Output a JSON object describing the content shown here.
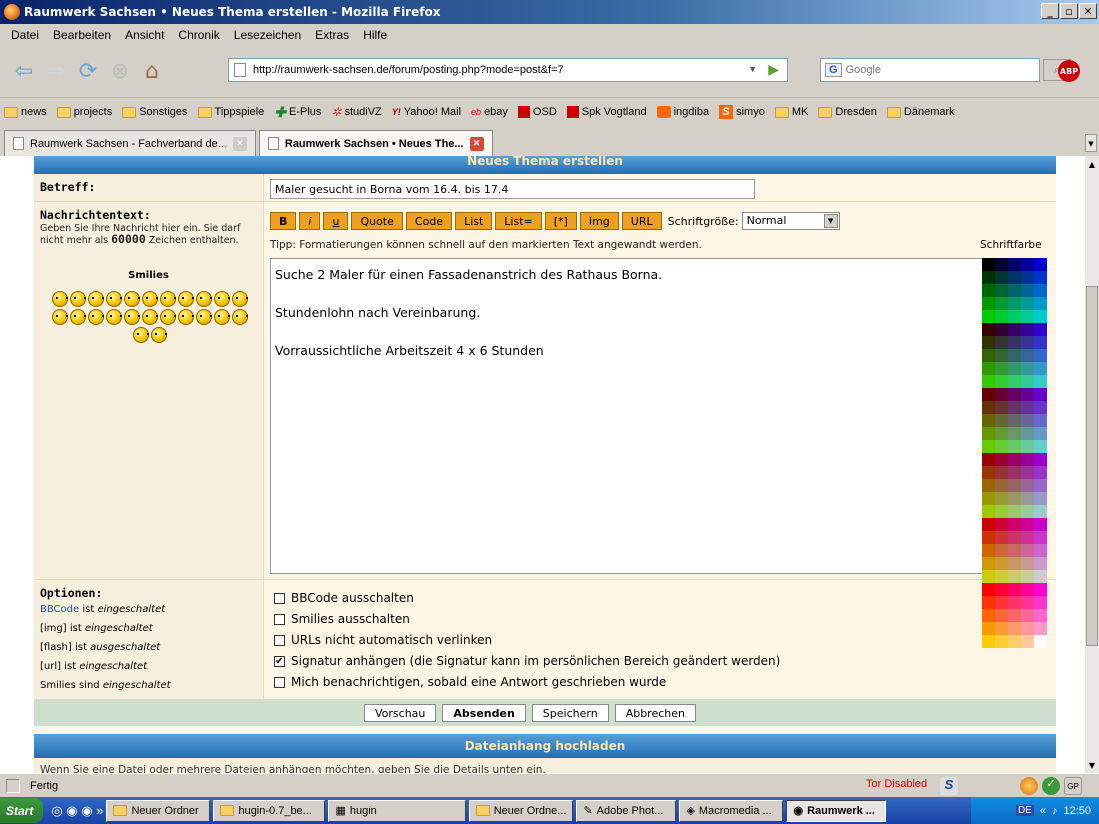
{
  "window": {
    "title": "Raumwerk Sachsen • Neues Thema erstellen - Mozilla Firefox"
  },
  "menu": [
    "Datei",
    "Bearbeiten",
    "Ansicht",
    "Chronik",
    "Lesezeichen",
    "Extras",
    "Hilfe"
  ],
  "nav": {
    "url": "http://raumwerk-sachsen.de/forum/posting.php?mode=post&f=7",
    "search_placeholder": "Google",
    "search_engine": "G",
    "adblock": "ABP"
  },
  "bookmarks": [
    {
      "label": "news",
      "icon": "folder"
    },
    {
      "label": "projects",
      "icon": "folder"
    },
    {
      "label": "Sonstiges",
      "icon": "folder"
    },
    {
      "label": "Tippspiele",
      "icon": "folder"
    },
    {
      "label": "E-Plus",
      "icon": "eplus"
    },
    {
      "label": "studiVZ",
      "icon": "studivz"
    },
    {
      "label": "Yahoo! Mail",
      "icon": "yahoo"
    },
    {
      "label": "ebay",
      "icon": "ebay"
    },
    {
      "label": "OSD",
      "icon": "sparkasse"
    },
    {
      "label": "Spk Vogtland",
      "icon": "sparkasse"
    },
    {
      "label": "ingdiba",
      "icon": "ingdiba"
    },
    {
      "label": "simyo",
      "icon": "simyo"
    },
    {
      "label": "MK",
      "icon": "folder"
    },
    {
      "label": "Dresden",
      "icon": "folder"
    },
    {
      "label": "Dänemark",
      "icon": "folder"
    }
  ],
  "tabs": [
    {
      "label": "Raumwerk Sachsen - Fachverband de...",
      "active": false
    },
    {
      "label": "Raumwerk Sachsen • Neues The...",
      "active": true
    }
  ],
  "form": {
    "header": "Neues Thema erstellen",
    "subject_label": "Betreff:",
    "subject_value": "Maler gesucht in Borna vom 16.4. bis 17.4",
    "message_label": "Nachrichtentext:",
    "message_hint": "Geben Sie Ihre Nachricht hier ein. Sie darf nicht mehr als ",
    "message_limit": "60000",
    "message_hint_end": " Zeichen enthalten.",
    "smilies_title": "Smilies",
    "bbcode_buttons": [
      "B",
      "i",
      "u",
      "Quote",
      "Code",
      "List",
      "List=",
      "[*]",
      "Img",
      "URL"
    ],
    "font_size_label": "Schriftgröße:",
    "font_size_value": "Normal",
    "tip": "Tipp: Formatierungen können schnell auf den markierten Text angewandt werden.",
    "font_color_label": "Schriftfarbe",
    "message_text": "Suche 2 Maler für einen Fassadenanstrich des Rathaus Borna.\n\nStundenlohn nach Vereinbarung.\n\nVorraussichtliche Arbeitszeit 4 x 6 Stunden",
    "options_label": "Optionen:",
    "options_status": [
      {
        "name": "BBCode",
        "text": " ist ",
        "state": "eingeschaltet"
      },
      {
        "name": "[img]",
        "text": " ist ",
        "state": "eingeschaltet"
      },
      {
        "name": "[flash]",
        "text": " ist ",
        "state": "ausgeschaltet"
      },
      {
        "name": "[url]",
        "text": " ist ",
        "state": "eingeschaltet"
      },
      {
        "name": "Smilies",
        "text": " sind ",
        "state": "eingeschaltet"
      }
    ],
    "checkboxes": [
      {
        "label": "BBCode ausschalten",
        "checked": false
      },
      {
        "label": "Smilies ausschalten",
        "checked": false
      },
      {
        "label": "URLs nicht automatisch verlinken",
        "checked": false
      },
      {
        "label": "Signatur anhängen (die Signatur kann im persönlichen Bereich geändert werden)",
        "checked": true
      },
      {
        "label": "Mich benachrichtigen, sobald eine Antwort geschrieben wurde",
        "checked": false
      }
    ],
    "buttons": [
      "Vorschau",
      "Absenden",
      "Speichern",
      "Abbrechen"
    ],
    "attach_header": "Dateianhang hochladen",
    "attach_hint": "Wenn Sie eine Datei oder mehrere Dateien anhängen möchten, geben Sie die Details unten ein."
  },
  "status": {
    "text": "Fertig",
    "tor": "Tor Disabled"
  },
  "taskbar": {
    "start": "Start",
    "items": [
      {
        "label": "Neuer Ordner",
        "active": false
      },
      {
        "label": "hugin-0.7_be...",
        "active": false
      },
      {
        "label": "hugin",
        "active": false
      },
      {
        "label": "Neuer Ordne...",
        "active": false
      },
      {
        "label": "Adobe Phot...",
        "active": false
      },
      {
        "label": "Macromedia ...",
        "active": false
      },
      {
        "label": "Raumwerk ...",
        "active": true
      }
    ],
    "lang": "DE",
    "clock": "12:50"
  },
  "palette_colors": [
    "#000000",
    "#000033",
    "#000066",
    "#000099",
    "#0000cc",
    "#003300",
    "#003333",
    "#003366",
    "#003399",
    "#0033cc",
    "#006600",
    "#006633",
    "#006666",
    "#006699",
    "#0066cc",
    "#009900",
    "#009933",
    "#009966",
    "#009999",
    "#0099cc",
    "#00cc00",
    "#00cc33",
    "#00cc66",
    "#00cc99",
    "#00cccc",
    "#330000",
    "#330033",
    "#330066",
    "#330099",
    "#3300cc",
    "#333300",
    "#333333",
    "#333366",
    "#333399",
    "#3333cc",
    "#336600",
    "#336633",
    "#336666",
    "#336699",
    "#3366cc",
    "#339900",
    "#339933",
    "#339966",
    "#339999",
    "#3399cc",
    "#33cc00",
    "#33cc33",
    "#33cc66",
    "#33cc99",
    "#33cccc",
    "#660000",
    "#660033",
    "#660066",
    "#660099",
    "#6600cc",
    "#663300",
    "#663333",
    "#663366",
    "#663399",
    "#6633cc",
    "#666600",
    "#666633",
    "#666666",
    "#666699",
    "#6666cc",
    "#669900",
    "#669933",
    "#669966",
    "#669999",
    "#6699cc",
    "#66cc00",
    "#66cc33",
    "#66cc66",
    "#66cc99",
    "#66cccc",
    "#990000",
    "#990033",
    "#990066",
    "#990099",
    "#9900cc",
    "#993300",
    "#993333",
    "#993366",
    "#993399",
    "#9933cc",
    "#996600",
    "#996633",
    "#996666",
    "#996699",
    "#9966cc",
    "#999900",
    "#999933",
    "#999966",
    "#999999",
    "#9999cc",
    "#99cc00",
    "#99cc33",
    "#99cc66",
    "#99cc99",
    "#99cccc",
    "#cc0000",
    "#cc0033",
    "#cc0066",
    "#cc0099",
    "#cc00cc",
    "#cc3300",
    "#cc3333",
    "#cc3366",
    "#cc3399",
    "#cc33cc",
    "#cc6600",
    "#cc6633",
    "#cc6666",
    "#cc6699",
    "#cc66cc",
    "#cc9900",
    "#cc9933",
    "#cc9966",
    "#cc9999",
    "#cc99cc",
    "#cccc00",
    "#cccc33",
    "#cccc66",
    "#cccc99",
    "#cccccc",
    "#ff0000",
    "#ff0033",
    "#ff0066",
    "#ff0099",
    "#ff00cc",
    "#ff3300",
    "#ff3333",
    "#ff3366",
    "#ff3399",
    "#ff33cc",
    "#ff6600",
    "#ff6633",
    "#ff6666",
    "#ff6699",
    "#ff66cc",
    "#ff9900",
    "#ff9933",
    "#ff9966",
    "#ff9999",
    "#ff99cc",
    "#ffcc00",
    "#ffcc33",
    "#ffcc66",
    "#ffcc99",
    "#ffffff"
  ]
}
